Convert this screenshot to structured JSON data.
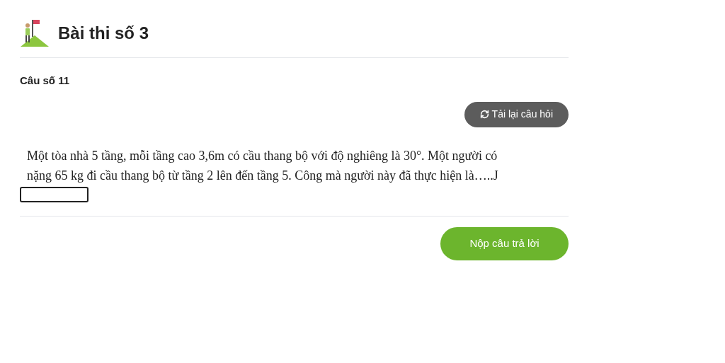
{
  "header": {
    "title": "Bài thi số 3"
  },
  "question": {
    "label": "Câu số 11",
    "reload_button": "Tải lại câu hỏi",
    "text": "Một tòa nhà 5 tầng, mỗi tầng cao 3,6m có cầu thang bộ với độ nghiêng là 30°. Một người có nặng 65 kg đi cầu thang bộ từ tầng 2 lên đến tầng 5. Công mà người này đã thực hiện là…..J"
  },
  "submit_button": "Nộp câu trả lời"
}
